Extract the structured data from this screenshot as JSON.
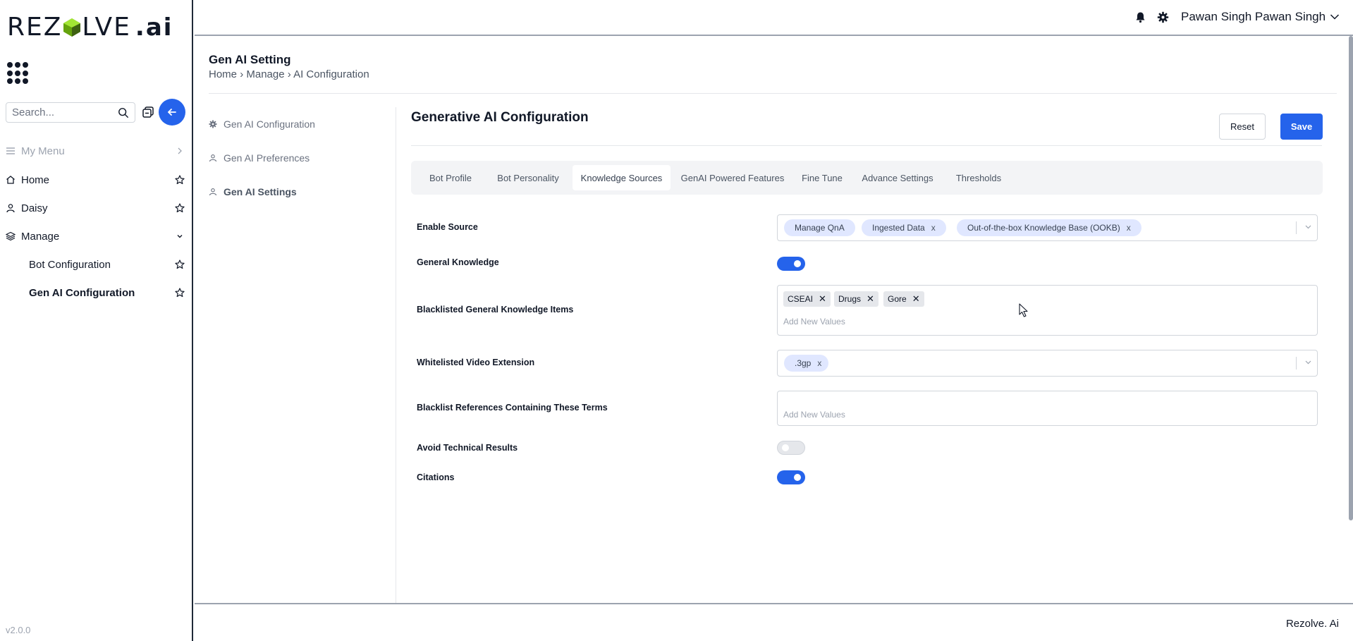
{
  "sidebar": {
    "logo_left": "REZ",
    "logo_right": "LVE",
    "logo_ai": ".ai",
    "search_placeholder": "Search...",
    "items": [
      {
        "label": "My Menu"
      },
      {
        "label": "Home"
      },
      {
        "label": "Daisy"
      },
      {
        "label": "Manage"
      },
      {
        "label": "Bot Configuration"
      },
      {
        "label": "Gen AI Configuration"
      }
    ],
    "version": "v2.0.0"
  },
  "topbar": {
    "user_name": "Pawan Singh Pawan Singh"
  },
  "page": {
    "title": "Gen AI Setting",
    "breadcrumb": [
      "Home",
      "Manage",
      "AI Configuration"
    ],
    "breadcrumb_sep": "›"
  },
  "secondary_nav": [
    {
      "label": "Gen AI Configuration"
    },
    {
      "label": "Gen AI Preferences"
    },
    {
      "label": "Gen AI Settings"
    }
  ],
  "main": {
    "title": "Generative AI Configuration",
    "reset_label": "Reset",
    "save_label": "Save",
    "tabs": [
      {
        "label": "Bot Profile"
      },
      {
        "label": "Bot Personality"
      },
      {
        "label": "Knowledge Sources"
      },
      {
        "label": "GenAI Powered Features"
      },
      {
        "label": "Fine Tune"
      },
      {
        "label": "Advance Settings"
      },
      {
        "label": "Thresholds"
      }
    ],
    "active_tab": "Knowledge Sources",
    "form": {
      "enable_source": {
        "label": "Enable Source",
        "chips": [
          "Manage QnA",
          "Ingested Data",
          "Out-of-the-box Knowledge Base (OOKB)"
        ]
      },
      "general_knowledge": {
        "label": "General Knowledge",
        "on": true
      },
      "blacklisted_items": {
        "label": "Blacklisted General Knowledge Items",
        "tags": [
          "CSEAI",
          "Drugs",
          "Gore"
        ],
        "placeholder": "Add New Values"
      },
      "whitelisted_video": {
        "label": "Whitelisted Video Extension",
        "chips": [
          ".3gp"
        ]
      },
      "blacklist_references": {
        "label": "Blacklist References Containing These Terms",
        "placeholder": "Add New Values"
      },
      "avoid_technical": {
        "label": "Avoid Technical Results",
        "on": false
      },
      "citations": {
        "label": "Citations",
        "on": true
      }
    }
  },
  "footer": {
    "brand": "Rezolve. Ai"
  },
  "colors": {
    "accent": "#2563eb",
    "chip_bg": "#e0e7ff",
    "tag_bg": "#e5e7eb"
  },
  "icons": {
    "x_chip": "x",
    "x_tag": "✕"
  }
}
